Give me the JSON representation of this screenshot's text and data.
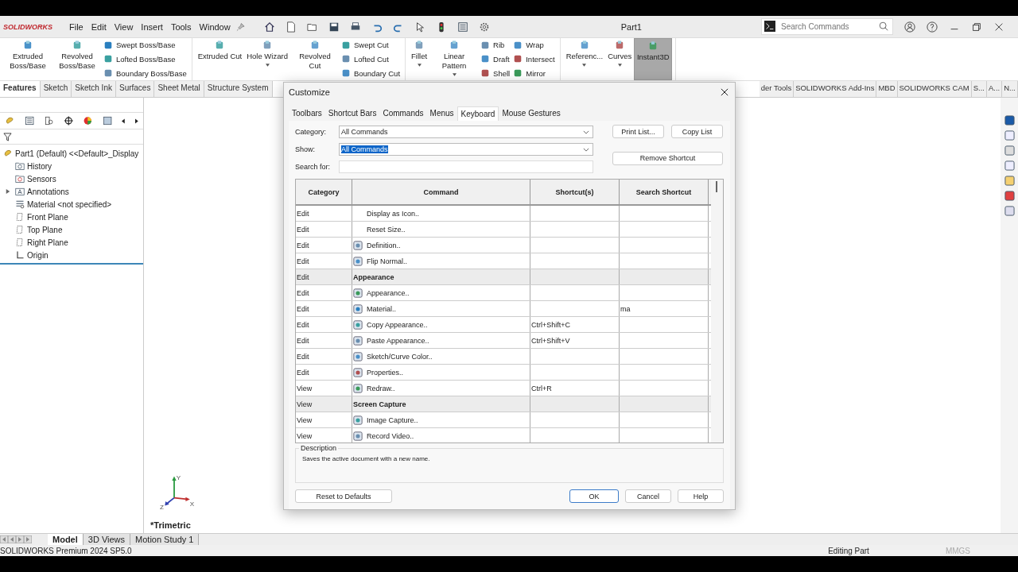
{
  "app": {
    "logo": "SOLIDWORKS",
    "menu": [
      "File",
      "Edit",
      "View",
      "Insert",
      "Tools",
      "Window"
    ],
    "title": "Part1",
    "search": {
      "placeholder": "Search Commands"
    }
  },
  "ribbon": {
    "groups": [
      {
        "large": [
          {
            "label": "Extruded Boss/Base",
            "dropdown": false,
            "selected": false
          },
          {
            "label": "Revolved Boss/Base",
            "dropdown": false,
            "selected": false
          }
        ],
        "stacks": [
          [
            "Swept Boss/Base",
            "Lofted Boss/Base",
            "Boundary Boss/Base"
          ]
        ]
      },
      {
        "large": [
          {
            "label": "Extruded Cut",
            "dropdown": false,
            "selected": false
          },
          {
            "label": "Hole Wizard",
            "dropdown": true,
            "selected": false
          },
          {
            "label": "Revolved Cut",
            "dropdown": false,
            "selected": false
          }
        ],
        "stacks": [
          [
            "Swept Cut",
            "Lofted Cut",
            "Boundary Cut"
          ]
        ]
      },
      {
        "large": [
          {
            "label": "Fillet",
            "dropdown": true,
            "selected": false
          },
          {
            "label": "Linear Pattern",
            "dropdown": true,
            "selected": false
          }
        ],
        "stacks": [
          [
            "Rib",
            "Draft",
            "Shell"
          ],
          [
            "Wrap",
            "Intersect",
            "Mirror"
          ]
        ]
      },
      {
        "large": [
          {
            "label": "Referenc...",
            "dropdown": true,
            "selected": false
          },
          {
            "label": "Curves",
            "dropdown": true,
            "selected": false
          },
          {
            "label": "Instant3D",
            "dropdown": false,
            "selected": true
          }
        ]
      }
    ]
  },
  "tabs_left": [
    {
      "label": "Features",
      "selected": true
    },
    {
      "label": "Sketch",
      "selected": false
    },
    {
      "label": "Sketch Ink",
      "selected": false
    },
    {
      "label": "Surfaces",
      "selected": false
    },
    {
      "label": "Sheet Metal",
      "selected": false
    },
    {
      "label": "Structure System",
      "selected": false
    }
  ],
  "tabs_right": [
    {
      "label": "der Tools",
      "selected": false
    },
    {
      "label": "SOLIDWORKS Add-Ins",
      "selected": false
    },
    {
      "label": "MBD",
      "selected": false
    },
    {
      "label": "SOLIDWORKS CAM",
      "selected": false
    },
    {
      "label": "S...",
      "selected": false
    },
    {
      "label": "A...",
      "selected": false
    },
    {
      "label": "N...",
      "selected": false
    }
  ],
  "tree": {
    "label": "Part1 (Default) <<Default>_Display",
    "children": [
      {
        "label": "History",
        "kind": "history",
        "has_children": false
      },
      {
        "label": "Sensors",
        "kind": "sensors",
        "has_children": false
      },
      {
        "label": "Annotations",
        "kind": "annotations",
        "has_children": true,
        "expanded": false
      },
      {
        "label": "Material <not specified>",
        "kind": "material",
        "has_children": false
      },
      {
        "label": "Front Plane",
        "kind": "plane",
        "has_children": false
      },
      {
        "label": "Top Plane",
        "kind": "plane",
        "has_children": false
      },
      {
        "label": "Right Plane",
        "kind": "plane",
        "has_children": false
      },
      {
        "label": "Origin",
        "kind": "origin",
        "has_children": false
      }
    ]
  },
  "viewport": {
    "view_name": "*Trimetric",
    "axes": [
      "Y",
      "Z",
      "X"
    ]
  },
  "dialog": {
    "title": "Customize",
    "tabs": [
      {
        "label": "Toolbars",
        "selected": false
      },
      {
        "label": "Shortcut Bars",
        "selected": false
      },
      {
        "label": "Commands",
        "selected": false
      },
      {
        "label": "Menus",
        "selected": false
      },
      {
        "label": "Keyboard",
        "selected": true
      },
      {
        "label": "Mouse Gestures",
        "selected": false
      }
    ],
    "category": {
      "label": "Category:",
      "value": "All Commands"
    },
    "show": {
      "label": "Show:",
      "value": "All Commands",
      "text_selected": true
    },
    "search_for": {
      "label": "Search for:"
    },
    "side_buttons": [
      "Print List...",
      "Copy List",
      "Remove Shortcut"
    ],
    "columns": [
      "Category",
      "Command",
      "Shortcut(s)",
      "Search Shortcut"
    ],
    "rows": [
      {
        "category": "Edit",
        "command": "Display as Icon..",
        "kind": "plain"
      },
      {
        "category": "Edit",
        "command": "Reset Size..",
        "kind": "plain"
      },
      {
        "category": "Edit",
        "command": "Definition..",
        "kind": "command"
      },
      {
        "category": "Edit",
        "command": "Flip Normal..",
        "kind": "command"
      },
      {
        "category": "Edit",
        "command": "Appearance",
        "kind": "group"
      },
      {
        "category": "Edit",
        "command": "Appearance..",
        "kind": "command"
      },
      {
        "category": "Edit",
        "command": "Material..",
        "kind": "command",
        "search": "ma"
      },
      {
        "category": "Edit",
        "command": "Copy Appearance..",
        "kind": "command",
        "shortcut": "Ctrl+Shift+C"
      },
      {
        "category": "Edit",
        "command": "Paste Appearance..",
        "kind": "command",
        "shortcut": "Ctrl+Shift+V"
      },
      {
        "category": "Edit",
        "command": "Sketch/Curve Color..",
        "kind": "command"
      },
      {
        "category": "Edit",
        "command": "Properties..",
        "kind": "command"
      },
      {
        "category": "View",
        "command": "Redraw..",
        "kind": "command",
        "shortcut": "Ctrl+R"
      },
      {
        "category": "View",
        "command": "Screen Capture",
        "kind": "group"
      },
      {
        "category": "View",
        "command": "Image Capture..",
        "kind": "command"
      },
      {
        "category": "View",
        "command": "Record Video..",
        "kind": "command"
      }
    ],
    "description": {
      "legend": "Description",
      "text": "Saves the active document with a new name."
    },
    "buttons": {
      "reset": "Reset to Defaults",
      "ok": "OK",
      "cancel": "Cancel",
      "help": "Help"
    }
  },
  "bottom_tabs": [
    {
      "label": "Model",
      "selected": true
    },
    {
      "label": "3D Views",
      "selected": false
    },
    {
      "label": "Motion Study 1",
      "selected": false
    }
  ],
  "status_bar": {
    "product": "SOLIDWORKS Premium 2024 SP5.0",
    "state": "Editing Part",
    "units": "MMGS"
  }
}
